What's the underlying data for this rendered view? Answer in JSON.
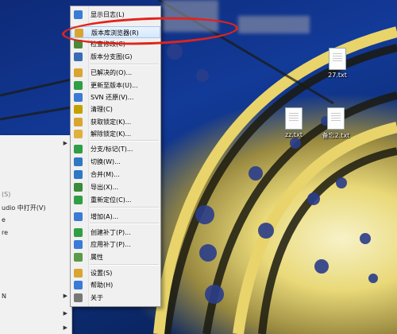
{
  "desktop_icons": [
    {
      "label": "27.txt"
    },
    {
      "label": "zz.txt"
    },
    {
      "label": "备忘2.txt"
    }
  ],
  "left_menu": [
    {
      "label": "(S)",
      "arrow": false
    },
    {
      "label": "udio 中打开(V)",
      "arrow": false
    },
    {
      "label": "e",
      "arrow": false
    },
    {
      "label": "re",
      "arrow": false
    },
    {
      "label": "N",
      "arrow": true
    }
  ],
  "context_menu": [
    {
      "label": "显示日志(L)",
      "icon_color": "#3a7bd5"
    },
    {
      "label": "版本库浏览器(R)",
      "icon_color": "#d9a531"
    },
    {
      "label": "检查修改(C)",
      "icon_color": "#4a8a3a"
    },
    {
      "label": "版本分支图(G)",
      "icon_color": "#3a6cb5"
    },
    {
      "label": "已解决的(O)...",
      "icon_color": "#d9a531"
    },
    {
      "label": "更新至版本(U)...",
      "icon_color": "#2f9e44"
    },
    {
      "label": "SVN 还原(V)...",
      "icon_color": "#3a7bd5"
    },
    {
      "label": "清理(C)",
      "icon_color": "#c4a000"
    },
    {
      "label": "获取锁定(K)...",
      "icon_color": "#d9a531"
    },
    {
      "label": "解除锁定(K)...",
      "icon_color": "#e0b040"
    },
    {
      "label": "分支/标记(T)...",
      "icon_color": "#2f9e44"
    },
    {
      "label": "切换(W)...",
      "icon_color": "#2f78c4"
    },
    {
      "label": "合并(M)...",
      "icon_color": "#2f78c4"
    },
    {
      "label": "导出(X)...",
      "icon_color": "#3a8a3a"
    },
    {
      "label": "重新定位(C)...",
      "icon_color": "#2f9e44"
    },
    {
      "label": "增加(A)...",
      "icon_color": "#3a7bd5"
    },
    {
      "label": "创建补丁(P)...",
      "icon_color": "#2f9e44"
    },
    {
      "label": "应用补丁(P)...",
      "icon_color": "#3a7bd5"
    },
    {
      "label": "属性",
      "icon_color": "#5a9a4a"
    },
    {
      "label": "设置(S)",
      "icon_color": "#d9a531"
    },
    {
      "label": "帮助(H)",
      "icon_color": "#3a7bd5"
    },
    {
      "label": "关于",
      "icon_color": "#777777"
    }
  ],
  "highlighted_item": "版本库浏览器(R)",
  "annotation": {
    "color": "#e2231a"
  }
}
